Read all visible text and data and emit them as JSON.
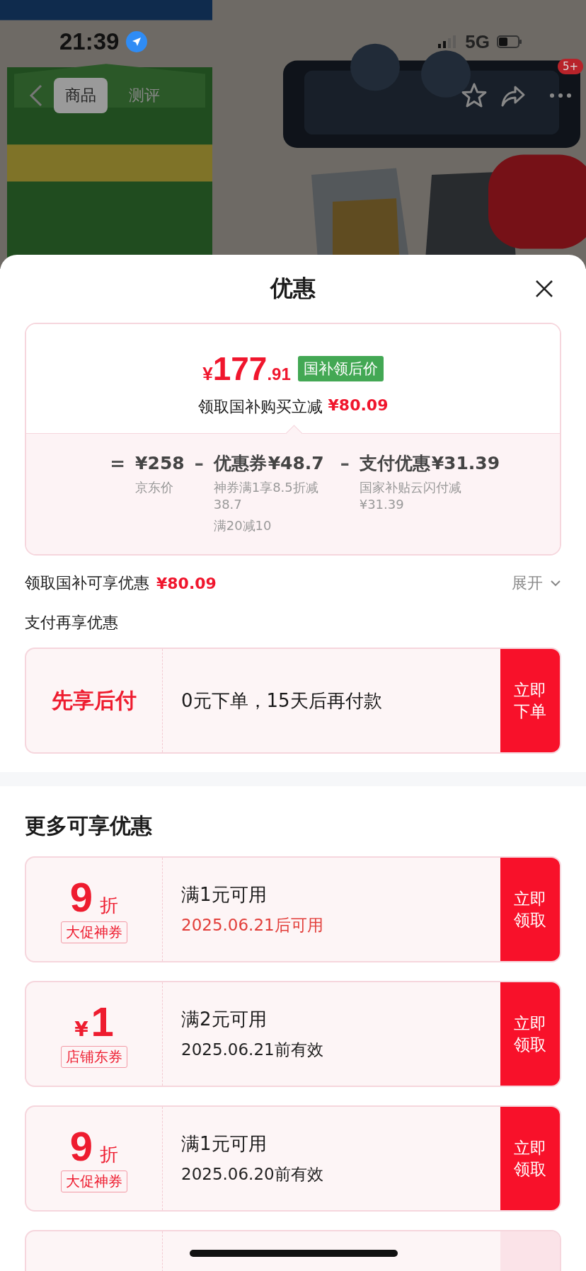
{
  "status_bar": {
    "time": "21:39",
    "network": "5G"
  },
  "nav": {
    "tabs": [
      {
        "label": "商品",
        "selected": true
      },
      {
        "label": "测评",
        "selected": false
      }
    ],
    "badge": "5+"
  },
  "sheet": {
    "title": "优惠",
    "summary": {
      "price": {
        "symbol": "¥",
        "integer": "177",
        "decimal": ".91"
      },
      "price_tag": "国补领后价",
      "saving_label": "领取国补购买立减",
      "saving_amount": "¥80.09",
      "breakdown": [
        {
          "op": "=",
          "amount": "¥258",
          "notes": [
            "京东价"
          ]
        },
        {
          "op": "–",
          "label": "优惠券",
          "amount": "¥48.7",
          "notes": [
            "神券满1享8.5折减38.7",
            "满20减10"
          ]
        },
        {
          "op": "–",
          "label": "支付优惠",
          "amount": "¥31.39",
          "notes": [
            "国家补贴云闪付减¥31.39"
          ]
        }
      ]
    },
    "subsidy_row": {
      "label": "领取国补可享优惠",
      "amount": "¥80.09",
      "toggle": "展开",
      "expanded": false
    },
    "pay_section": {
      "title": "支付再享优惠",
      "card": {
        "name": "先享后付",
        "description": "0元下单，15天后再付款",
        "button": "立即下单"
      }
    },
    "more_section": {
      "title": "更多可享优惠",
      "coupons": [
        {
          "kind": "discount",
          "value": "9",
          "unit": "折",
          "tag": "大促神券",
          "condition": "满1元可用",
          "validity": "2025.06.21后可用",
          "highlight": true,
          "button": "立即领取"
        },
        {
          "kind": "cash",
          "value": "1",
          "unit": "¥",
          "tag": "店铺东券",
          "condition": "满2元可用",
          "validity": "2025.06.21前有效",
          "highlight": false,
          "button": "立即领取"
        },
        {
          "kind": "discount",
          "value": "9",
          "unit": "折",
          "tag": "大促神券",
          "condition": "满1元可用",
          "validity": "2025.06.20前有效",
          "highlight": false,
          "button": "立即领取"
        }
      ]
    }
  }
}
